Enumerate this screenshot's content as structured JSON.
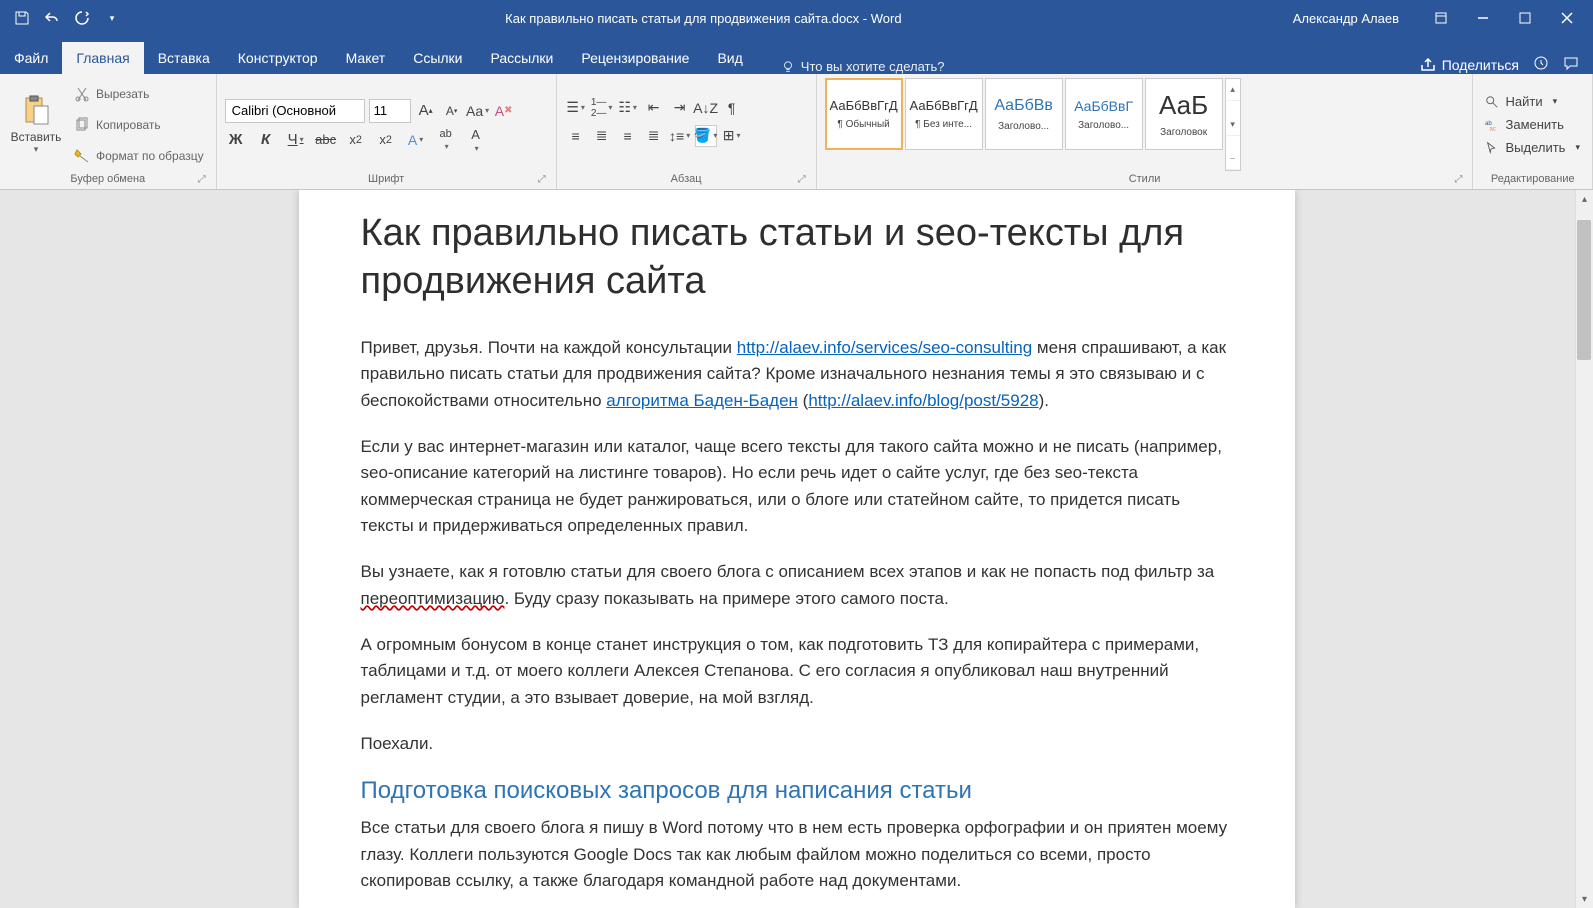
{
  "titlebar": {
    "doc_title": "Как правильно писать статьи для продвижения сайта.docx  -  Word",
    "user": "Александр Алаев"
  },
  "tabs": {
    "file": "Файл",
    "items": [
      "Главная",
      "Вставка",
      "Конструктор",
      "Макет",
      "Ссылки",
      "Рассылки",
      "Рецензирование",
      "Вид"
    ],
    "active_index": 0,
    "tell_me": "Что вы хотите сделать?",
    "share": "Поделиться"
  },
  "ribbon": {
    "clipboard": {
      "paste": "Вставить",
      "cut": "Вырезать",
      "copy": "Копировать",
      "format_painter": "Формат по образцу",
      "label": "Буфер обмена"
    },
    "font": {
      "name": "Calibri (Основной",
      "size": "11",
      "label": "Шрифт"
    },
    "paragraph": {
      "label": "Абзац"
    },
    "styles": {
      "label": "Стили",
      "items": [
        {
          "sample": "АаБбВвГгД",
          "name": "¶ Обычный"
        },
        {
          "sample": "АаБбВвГгД",
          "name": "¶ Без инте..."
        },
        {
          "sample": "АаБбВв",
          "name": "Заголово..."
        },
        {
          "sample": "АаБбВвГ",
          "name": "Заголово..."
        },
        {
          "sample": "АаБ",
          "name": "Заголовок"
        }
      ]
    },
    "editing": {
      "find": "Найти",
      "replace": "Заменить",
      "select": "Выделить",
      "label": "Редактирование"
    }
  },
  "document": {
    "title": "Как правильно писать статьи и seo-тексты для продвижения сайта",
    "p1_a": "Привет, друзья. Почти на каждой консультации ",
    "link1": "http://alaev.info/services/seo-consulting",
    "p1_b": " меня спрашивают, а как правильно писать статьи для продвижения сайта? Кроме изначального незнания темы я это связываю и с беспокойствами относительно ",
    "link2_text": "алгоритма Баден-Баден",
    "p1_c": " (",
    "link3": "http://alaev.info/blog/post/5928",
    "p1_d": ").",
    "p2": "Если у вас интернет-магазин или каталог, чаще всего тексты для такого сайта можно и не писать (например, seo-описание категорий на листинге товаров). Но если речь идет о сайте услуг, где без seo-текста коммерческая страница не будет ранжироваться, или о блоге или статейном сайте, то придется писать тексты и придерживаться определенных правил.",
    "p3_a": "Вы узнаете, как я готовлю статьи для своего блога с описанием всех этапов и как не попасть под фильтр за ",
    "p3_wavy": "переоптимизацию",
    "p3_b": ". Буду сразу показывать на примере этого самого поста.",
    "p4": "А огромным бонусом в конце станет инструкция о том, как подготовить ТЗ для копирайтера с примерами, таблицами и т.д. от моего коллеги Алексея Степанова. С его согласия я опубликовал наш внутренний регламент студии, а это взывает доверие, на мой взгляд.",
    "p5": "Поехали.",
    "h2": "Подготовка поисковых запросов для написания статьи",
    "p6": "Все статьи для своего блога я пишу в Word потому что в нем есть проверка орфографии и он приятен моему глазу. Коллеги пользуются Google Docs так как любым файлом можно поделиться со всеми, просто скопировав ссылку, а также благодаря командной работе над документами."
  }
}
